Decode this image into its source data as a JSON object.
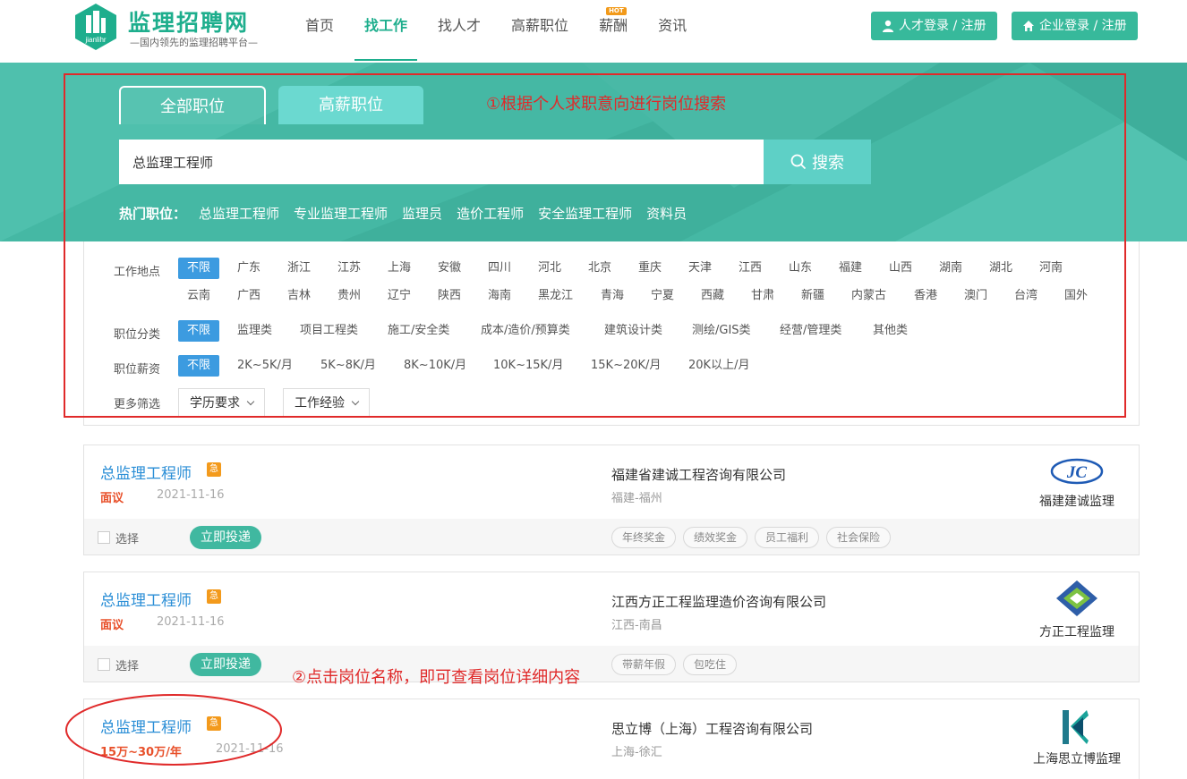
{
  "header": {
    "logo_title": "监理招聘网",
    "logo_sub": "—国内领先的监理招聘平台—",
    "logo_mark_text": "jianlihr",
    "nav": [
      "首页",
      "找工作",
      "找人才",
      "高薪职位",
      "薪酬",
      "资讯"
    ],
    "hot_badge": "HOT",
    "talent_login": "人才登录 / 注册",
    "company_login": "企业登录 / 注册"
  },
  "hero": {
    "tab_all": "全部职位",
    "tab_high": "高薪职位",
    "search_value": "总监理工程师",
    "search_button": "搜索",
    "hot_label": "热门职位：",
    "hot_items": [
      "总监理工程师",
      "专业监理工程师",
      "监理员",
      "造价工程师",
      "安全监理工程师",
      "资料员"
    ]
  },
  "annotations": {
    "step1": "①根据个人求职意向进行岗位搜索",
    "step2": "②点击岗位名称，即可查看岗位详细内容"
  },
  "filters": {
    "location_label": "工作地点",
    "locations_row1": [
      "不限",
      "广东",
      "浙江",
      "江苏",
      "上海",
      "安徽",
      "四川",
      "河北",
      "北京",
      "重庆",
      "天津",
      "江西",
      "山东",
      "福建",
      "山西",
      "湖南",
      "湖北",
      "河南"
    ],
    "locations_row2": [
      "云南",
      "广西",
      "吉林",
      "贵州",
      "辽宁",
      "陕西",
      "海南",
      "黑龙江",
      "青海",
      "宁夏",
      "西藏",
      "甘肃",
      "新疆",
      "内蒙古",
      "香港",
      "澳门",
      "台湾",
      "国外"
    ],
    "category_label": "职位分类",
    "categories": [
      "不限",
      "监理类",
      "项目工程类",
      "施工/安全类",
      "成本/造价/预算类",
      "建筑设计类",
      "测绘/GIS类",
      "经营/管理类",
      "其他类"
    ],
    "salary_label": "职位薪资",
    "salaries": [
      "不限",
      "2K~5K/月",
      "5K~8K/月",
      "8K~10K/月",
      "10K~15K/月",
      "15K~20K/月",
      "20K以上/月"
    ],
    "more_label": "更多筛选",
    "edu_dropdown": "学历要求",
    "exp_dropdown": "工作经验"
  },
  "jobs": [
    {
      "title": "总监理工程师",
      "urgent": "急",
      "salary": "面议",
      "date": "2021-11-16",
      "company": "福建省建诚工程咨询有限公司",
      "location": "福建-福州",
      "brand": "福建建诚监理",
      "brand_mark": "JC",
      "select": "选择",
      "apply": "立即投递",
      "tags": [
        "年终奖金",
        "绩效奖金",
        "员工福利",
        "社会保险"
      ]
    },
    {
      "title": "总监理工程师",
      "urgent": "急",
      "salary": "面议",
      "date": "2021-11-16",
      "company": "江西方正工程监理造价咨询有限公司",
      "location": "江西-南昌",
      "brand": "方正工程监理",
      "select": "选择",
      "apply": "立即投递",
      "tags": [
        "带薪年假",
        "包吃住"
      ]
    },
    {
      "title": "总监理工程师",
      "urgent": "急",
      "salary": "15万~30万/年",
      "date": "2021-11-16",
      "company": "思立博（上海）工程咨询有限公司",
      "location": "上海-徐汇",
      "brand": "上海思立博监理"
    }
  ]
}
